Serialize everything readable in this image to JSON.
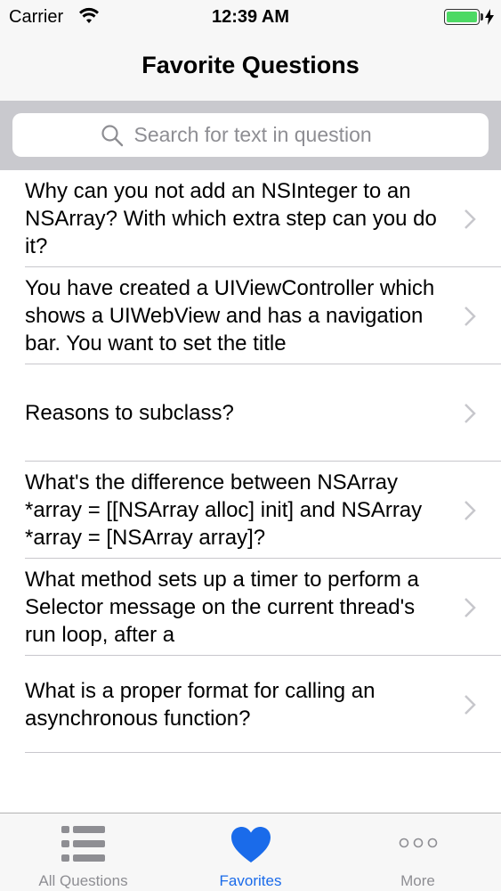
{
  "status_bar": {
    "carrier": "Carrier",
    "time": "12:39 AM",
    "battery_color": "#4cd964"
  },
  "nav": {
    "title": "Favorite Questions"
  },
  "search": {
    "placeholder": "Search for text in question",
    "icon": "magnifying-glass"
  },
  "questions": [
    {
      "text": "Why can you not add an NSInteger to an NSArray? With which extra step can you do it?"
    },
    {
      "text": "You have created a UIViewController which shows a UIWebView and has a navigation bar. You want to set the title"
    },
    {
      "text": "Reasons to subclass?"
    },
    {
      "text": "What's the difference between NSArray *array = [[NSArray alloc] init] and NSArray *array = [NSArray array]?"
    },
    {
      "text": "What method sets up a timer to perform a Selector message on the current thread's run loop, after a"
    },
    {
      "text": "What is a proper format for calling an asynchronous function?"
    }
  ],
  "tab_bar": {
    "tabs": [
      {
        "label": "All Questions",
        "icon": "list-icon",
        "active": false
      },
      {
        "label": "Favorites",
        "icon": "heart-icon",
        "active": true
      },
      {
        "label": "More",
        "icon": "more-icon",
        "active": false
      }
    ],
    "active_color": "#1a6bea",
    "inactive_color": "#8e8e93"
  }
}
